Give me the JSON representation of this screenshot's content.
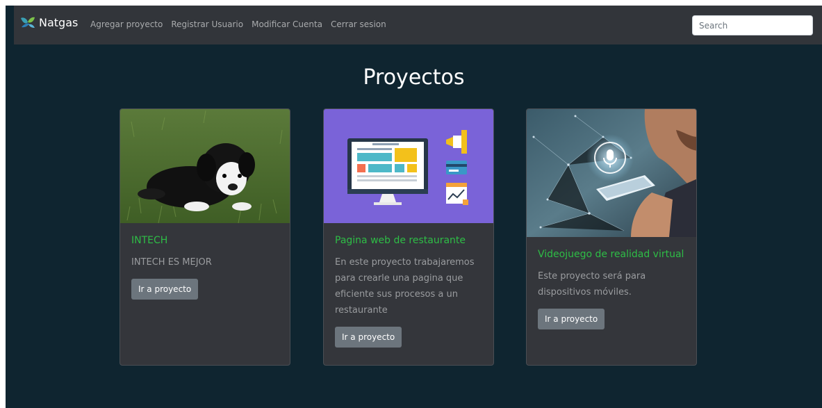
{
  "navbar": {
    "brand": "Natgas",
    "links": [
      "Agregar proyecto",
      "Registrar Usuario",
      "Modificar Cuenta",
      "Cerrar sesion"
    ],
    "search_placeholder": "Search"
  },
  "page_title": "Proyectos",
  "projects": [
    {
      "title": "INTECH",
      "description": "INTECH ES MEJOR",
      "button": "Ir a proyecto",
      "image": "puppy-on-grass-photo"
    },
    {
      "title": "Pagina web de restaurante",
      "description": "En este proyecto trabajaremos para crearle una pagina que eficiente sus procesos a un restaurante",
      "button": "Ir a proyecto",
      "image": "web-design-illustration"
    },
    {
      "title": "Videojuego de realidad virtual",
      "description": "Este proyecto será para dispositivos móviles.",
      "button": "Ir a proyecto",
      "image": "voice-assistant-phone-photo"
    }
  ],
  "colors": {
    "page_bg": "#0f2530",
    "navbar_bg": "#32353a",
    "card_bg": "#34363b",
    "title_green": "#2ebd46",
    "button_gray": "#6c757d"
  }
}
